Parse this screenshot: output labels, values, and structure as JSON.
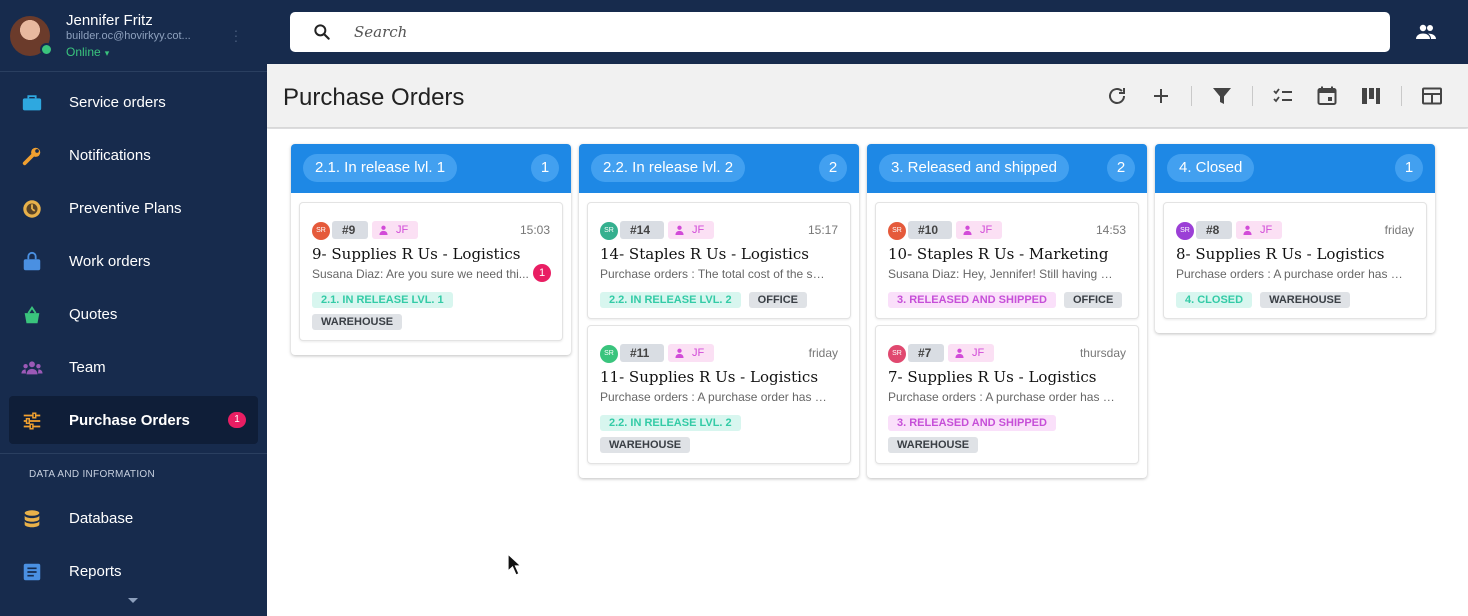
{
  "user": {
    "name": "Jennifer Fritz",
    "email": "builder.oc@hovirkyy.cot...",
    "status": "Online"
  },
  "sidebar": {
    "items": [
      {
        "label": "Service orders",
        "icon": "briefcase-icon",
        "color": "#2ea8e0"
      },
      {
        "label": "Notifications",
        "icon": "wrench-icon",
        "color": "#f0a030"
      },
      {
        "label": "Preventive Plans",
        "icon": "clock-icon",
        "color": "#e8b14a"
      },
      {
        "label": "Work orders",
        "icon": "bag-icon",
        "color": "#4a90e2"
      },
      {
        "label": "Quotes",
        "icon": "basket-icon",
        "color": "#3ac47d"
      },
      {
        "label": "Team",
        "icon": "group-icon",
        "color": "#9b59b6"
      },
      {
        "label": "Purchase Orders",
        "icon": "sliders-icon",
        "color": "#f0a030",
        "badge": "1",
        "active": true
      }
    ],
    "section_title": "DATA AND INFORMATION",
    "section_items": [
      {
        "label": "Database",
        "icon": "database-icon",
        "color": "#e8b14a"
      },
      {
        "label": "Reports",
        "icon": "report-icon",
        "color": "#4a90e2"
      }
    ]
  },
  "search": {
    "placeholder": "Search"
  },
  "page": {
    "title": "Purchase Orders"
  },
  "toolbar": {
    "icons": [
      "refresh-icon",
      "add-icon",
      "filter-icon",
      "checklist-icon",
      "calendar-icon",
      "kanban-icon",
      "table-icon"
    ]
  },
  "columns": [
    {
      "title": "2.1. In release lvl. 1",
      "count": "1",
      "cards": [
        {
          "avatar": "SR",
          "avatar_color": "#e55a3b",
          "number": "#9",
          "user": "JF",
          "time": "15:03",
          "title": "9- Supplies R Us - Logistics",
          "desc": "Susana Diaz: Are you sure we need thi...",
          "unread": "1",
          "status": "2.1. IN RELEASE LVL. 1",
          "status_style": "green",
          "location": "WAREHOUSE"
        }
      ]
    },
    {
      "title": "2.2. In release lvl. 2",
      "count": "2",
      "cards": [
        {
          "avatar": "SR",
          "avatar_color": "#35b08f",
          "number": "#14",
          "user": "JF",
          "time": "15:17",
          "title": "14- Staples R Us - Logistics",
          "desc": "Purchase orders : The total cost of the se...",
          "status": "2.2. IN RELEASE LVL. 2",
          "status_style": "green",
          "location": "OFFICE"
        },
        {
          "avatar": "SR",
          "avatar_color": "#3ac47d",
          "number": "#11",
          "user": "JF",
          "time": "friday",
          "title": "11- Supplies R Us - Logistics",
          "desc": "Purchase orders : A purchase order has b...",
          "status": "2.2. IN RELEASE LVL. 2",
          "status_style": "green",
          "location": "WAREHOUSE"
        }
      ]
    },
    {
      "title": "3. Released and shipped",
      "count": "2",
      "cards": [
        {
          "avatar": "SR",
          "avatar_color": "#e55a3b",
          "number": "#10",
          "user": "JF",
          "time": "14:53",
          "title": "10- Staples R Us - Marketing",
          "desc": "Susana Diaz: Hey, Jennifer! Still having pr...",
          "status": "3. RELEASED AND SHIPPED",
          "status_style": "purple",
          "location": "OFFICE"
        },
        {
          "avatar": "SR",
          "avatar_color": "#e0486f",
          "number": "#7",
          "user": "JF",
          "time": "thursday",
          "title": "7- Supplies R Us - Logistics",
          "desc": "Purchase orders : A purchase order has b...",
          "status": "3. RELEASED AND SHIPPED",
          "status_style": "purple",
          "location": "WAREHOUSE"
        }
      ]
    },
    {
      "title": "4. Closed",
      "count": "1",
      "cards": [
        {
          "avatar": "SR",
          "avatar_color": "#9b3fd6",
          "number": "#8",
          "user": "JF",
          "time": "friday",
          "title": "8- Supplies R Us - Logistics",
          "desc": "Purchase orders : A purchase order has b...",
          "status": "4. CLOSED",
          "status_style": "green",
          "location": "WAREHOUSE"
        }
      ]
    }
  ]
}
